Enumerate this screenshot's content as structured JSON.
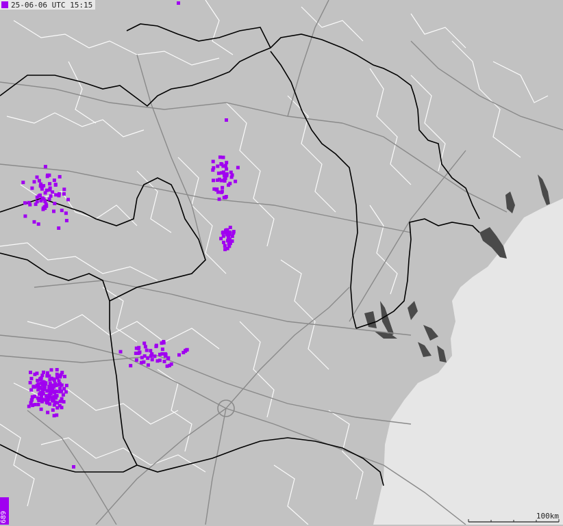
{
  "timestamp": "25-06-06 UTC 15:15",
  "strike_count": "689",
  "scale_label": "100km",
  "colors": {
    "land": "#c2c2c2",
    "sea": "#e6e6e6",
    "border": "#000000",
    "roads": "#8a8a8a",
    "admin": "#ffffff",
    "lakes": "#4a4a4a",
    "strike": "#a000f0"
  },
  "strike_clusters": [
    {
      "name": "northwest",
      "points": 60
    },
    {
      "name": "north-central",
      "points": 45
    },
    {
      "name": "central",
      "points": 30
    },
    {
      "name": "southwest",
      "points": 150
    },
    {
      "name": "south-central",
      "points": 50
    }
  ]
}
